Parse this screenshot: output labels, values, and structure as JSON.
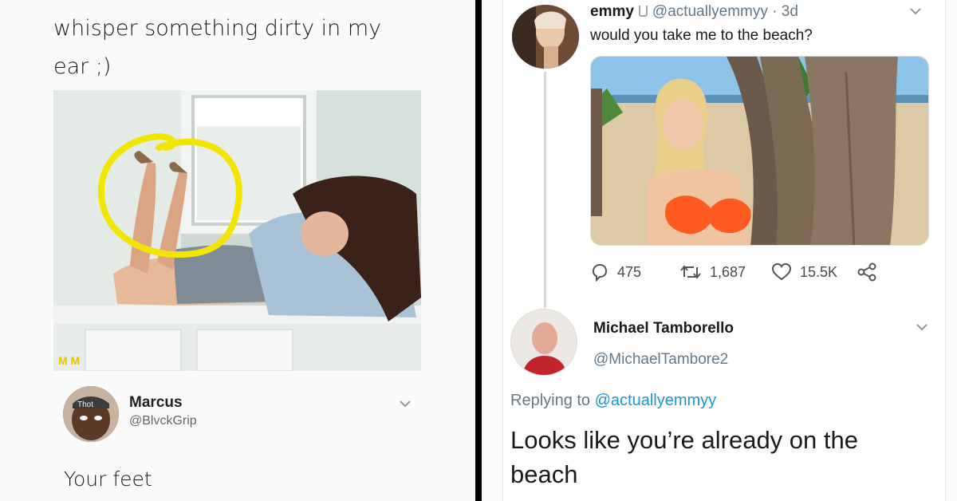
{
  "left_post": {
    "text": "whisper something dirty in my ear ;)"
  },
  "left_reply": {
    "name": "Marcus",
    "handle": "@BlvckGrip",
    "text": "Your feet",
    "avatar_caption": "Thot"
  },
  "right_tweet": {
    "name": "emmy",
    "handle": "@actuallyemmyy",
    "time": "· 3d",
    "text": "would you take me to the beach?",
    "replies": "475",
    "retweets": "1,687",
    "likes": "15.5K"
  },
  "right_reply": {
    "name": "Michael Tamborello",
    "handle": "@MichaelTambore2",
    "replying_prefix": "Replying to ",
    "replying_to": "@actuallyemmyy",
    "text": "Looks like you’re already on the beach"
  },
  "icons": {
    "reply": "comment-icon",
    "retweet": "retweet-icon",
    "like": "heart-icon",
    "share": "share-icon",
    "menu": "chevron-down-icon"
  },
  "colors": {
    "link": "#1b95e0",
    "handle": "#657786",
    "highlight_circle": "#f2e600",
    "bikini": "#ff5a1f"
  }
}
